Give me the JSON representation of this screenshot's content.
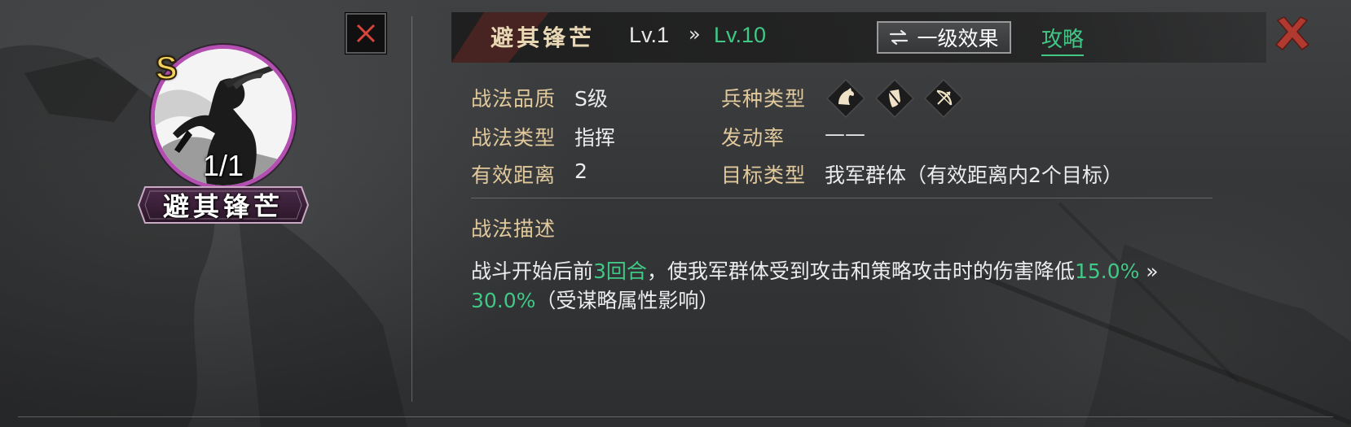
{
  "skill": {
    "name": "避其锋芒",
    "grade_badge": "S",
    "count": "1/1"
  },
  "header": {
    "title": "避其锋芒",
    "level_from": "Lv.1",
    "level_arrow": "»",
    "level_to": "Lv.10",
    "effect_button": {
      "icon": "swap-arrows-icon",
      "label": "一级效果"
    },
    "guide_link": "攻略"
  },
  "attributes": {
    "quality": {
      "label": "战法品质",
      "value": "S级"
    },
    "skill_type": {
      "label": "战法类型",
      "value": "指挥"
    },
    "range": {
      "label": "有效距离",
      "value": "2"
    },
    "troop_type": {
      "label": "兵种类型",
      "icons": [
        "cavalry-icon",
        "shield-infantry-icon",
        "archer-bow-icon"
      ]
    },
    "trigger_rate": {
      "label": "发动率",
      "value": "——"
    },
    "target_type": {
      "label": "目标类型",
      "value": "我军群体（有效距离内2个目标）"
    }
  },
  "description": {
    "title": "战法描述",
    "part1": "战斗开始后前",
    "rounds": "3回合",
    "part2": "，使我军群体受到攻击和策略攻击时的伤害降低",
    "value_from": "15.0%",
    "arrow": " »",
    "value_to": "30.0%",
    "part3": "（受谋略属性影响）"
  },
  "colors": {
    "highlight_green": "#41c886",
    "label_gold": "#e2c99c",
    "portrait_ring": "#b34fb0",
    "close_red": "#c0392b",
    "grade_gold": "#f1d35c"
  }
}
